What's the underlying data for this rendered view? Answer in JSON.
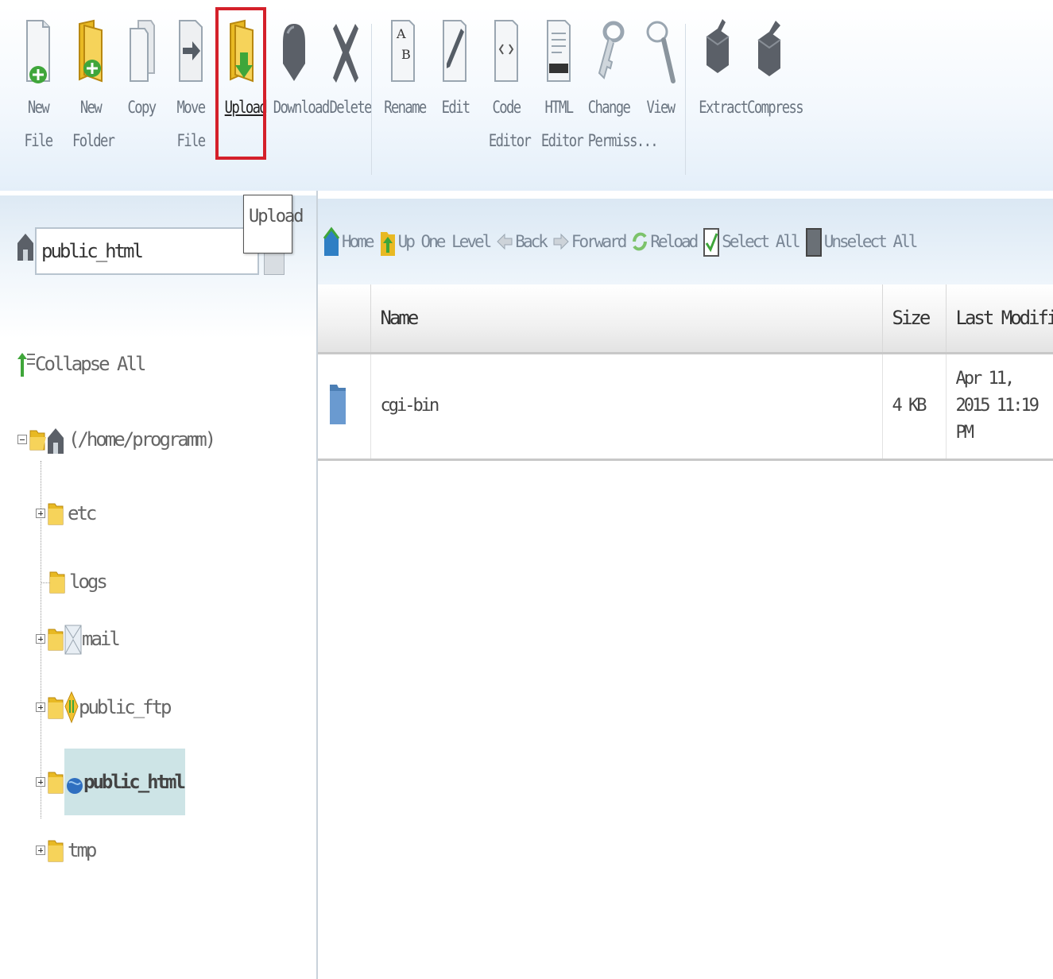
{
  "toolbar": {
    "buttons": [
      {
        "label": "New File",
        "icon": "new-file-icon"
      },
      {
        "label": "New\nFolder",
        "icon": "new-folder-icon"
      },
      {
        "label": "Copy",
        "icon": "copy-icon"
      },
      {
        "label": "Move File",
        "icon": "move-file-icon"
      },
      {
        "label": "Upload",
        "icon": "upload-icon"
      },
      {
        "label": "Download",
        "icon": "download-icon"
      },
      {
        "label": "Delete",
        "icon": "delete-icon"
      },
      {
        "label": "Rename",
        "icon": "rename-icon"
      },
      {
        "label": "Edit",
        "icon": "edit-icon"
      },
      {
        "label": "Code\nEditor",
        "icon": "code-editor-icon"
      },
      {
        "label": "HTML\nEditor",
        "icon": "html-editor-icon"
      },
      {
        "label": "Change\nPermiss...",
        "icon": "key-icon"
      },
      {
        "label": "View",
        "icon": "magnifier-icon"
      },
      {
        "label": "Extract",
        "icon": "extract-icon"
      },
      {
        "label": "Compress",
        "icon": "compress-icon"
      }
    ],
    "tooltip": "Upload",
    "highlight_color": "#d4202a"
  },
  "sidebar": {
    "path_value": "public_html",
    "collapse_all": "Collapse All",
    "root": "(/home/programm)",
    "folders": [
      "etc",
      "logs",
      "mail",
      "public_ftp",
      "public_html",
      "tmp"
    ]
  },
  "nav": {
    "home": "Home",
    "up_one_level": "Up One Level",
    "back": "Back",
    "forward": "Forward",
    "reload": "Reload",
    "select_all": "Select All",
    "unselect_all": "Unselect All"
  },
  "table": {
    "headers": {
      "name": "Name",
      "size": "Size",
      "modified": "Last Modified (Pacific"
    },
    "rows": [
      {
        "name": "cgi-bin",
        "size": "4 KB",
        "modified": "Apr 11, 2015 11:19 PM"
      }
    ]
  },
  "colors": {
    "selected_node_bg": "#cde4e6",
    "folder": "#e8b923"
  }
}
